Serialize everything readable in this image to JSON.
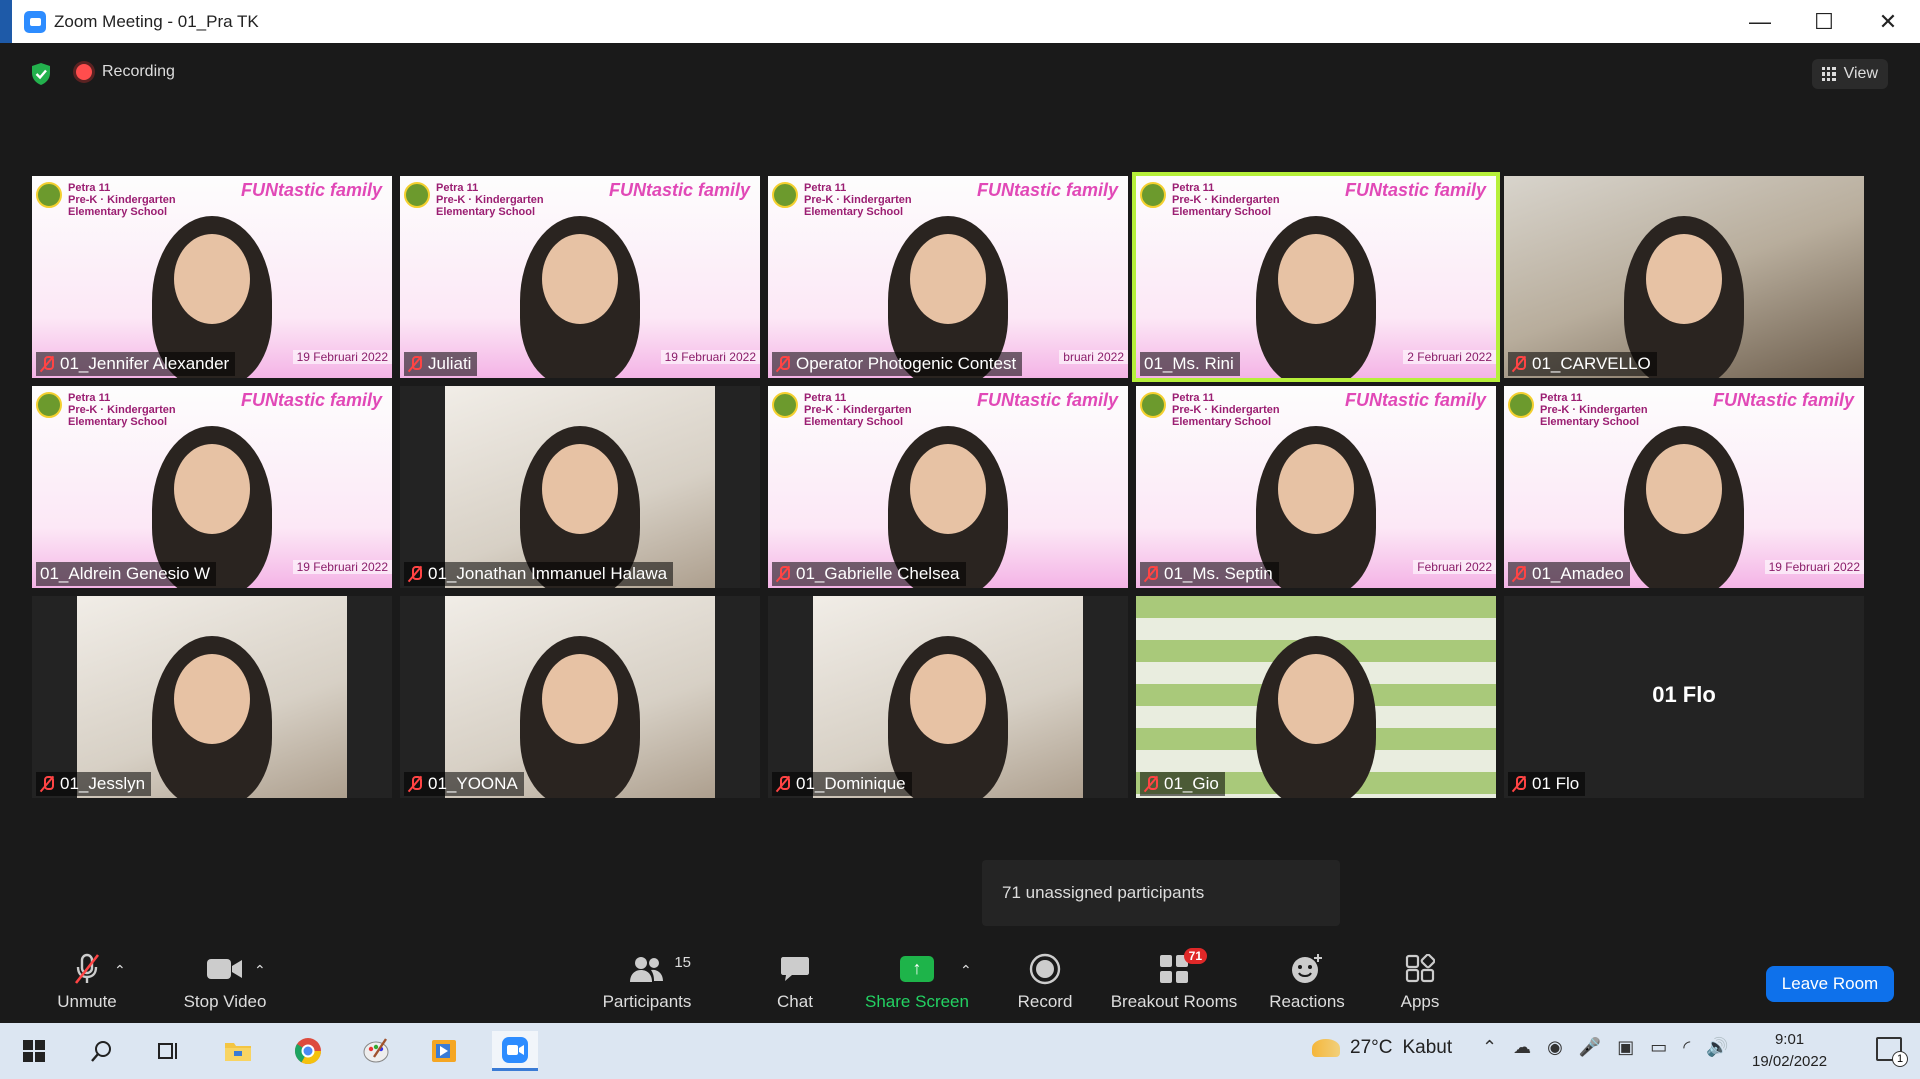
{
  "window": {
    "title": "Zoom Meeting - 01_Pra TK",
    "min": "—",
    "max": "☐",
    "close": "✕"
  },
  "topbar": {
    "recording_label": "Recording",
    "view_label": "View"
  },
  "participants_tiles": [
    {
      "name": "01_Jennifer Alexander",
      "muted": true,
      "scheme": "pink",
      "date": "19 Februari 2022"
    },
    {
      "name": "Juliati",
      "muted": true,
      "scheme": "pink",
      "date": "19 Februari 2022"
    },
    {
      "name": "Operator Photogenic Contest",
      "muted": true,
      "scheme": "pink",
      "date": "bruari 2022"
    },
    {
      "name": "01_Ms. Rini",
      "muted": false,
      "scheme": "pink",
      "date": "2 Februari 2022",
      "active": true
    },
    {
      "name": "01_CARVELLO",
      "muted": true,
      "scheme": "room"
    },
    {
      "name": "01_Aldrein Genesio W",
      "muted": false,
      "scheme": "pink",
      "date": "19 Februari 2022"
    },
    {
      "name": "01_Jonathan Immanuel Halawa",
      "muted": true,
      "scheme": "bright"
    },
    {
      "name": "01_Gabrielle Chelsea",
      "muted": true,
      "scheme": "pink"
    },
    {
      "name": "01_Ms. Septin",
      "muted": true,
      "scheme": "pink",
      "date": "Februari 2022"
    },
    {
      "name": "01_Amadeo",
      "muted": true,
      "scheme": "pink",
      "date": "19 Februari 2022"
    },
    {
      "name": "01_Jesslyn",
      "muted": true,
      "scheme": "bright"
    },
    {
      "name": "01_YOONA",
      "muted": true,
      "scheme": "bright"
    },
    {
      "name": "01_Dominique",
      "muted": true,
      "scheme": "bright"
    },
    {
      "name": "01_Gio",
      "muted": true,
      "scheme": "green"
    },
    {
      "name": "01 Flo",
      "muted": true,
      "scheme": "none",
      "big_name": "01 Flo"
    }
  ],
  "school_logo_text": [
    "Petra 11",
    "Pre-K · Kindergarten",
    "Elementary School"
  ],
  "family_text": "FUNtastic family",
  "tooltip": "71 unassigned participants",
  "toolbar": {
    "unmute": "Unmute",
    "stop_video": "Stop Video",
    "participants": "Participants",
    "participants_count": "15",
    "chat": "Chat",
    "share_screen": "Share Screen",
    "record": "Record",
    "breakout_rooms": "Breakout Rooms",
    "breakout_badge": "71",
    "reactions": "Reactions",
    "apps": "Apps",
    "leave_room": "Leave Room"
  },
  "taskbar": {
    "temperature": "27°C",
    "weather": "Kabut",
    "time": "9:01",
    "date": "19/02/2022",
    "notifications": "1"
  },
  "colors": {
    "active_speaker": "#b6f03a",
    "leave_button": "#0e71eb",
    "share_green": "#1eb44a",
    "badge_red": "#e02828"
  }
}
